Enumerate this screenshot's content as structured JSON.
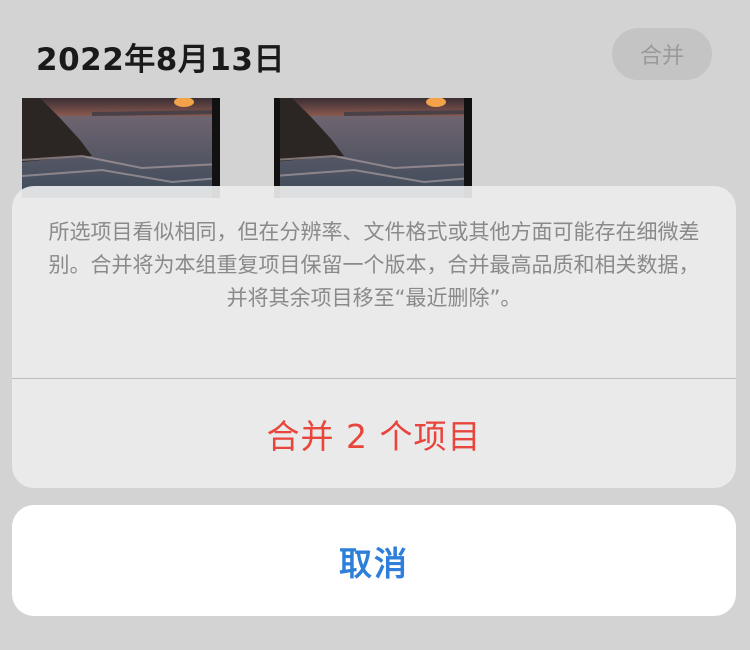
{
  "header": {
    "date_title": "2022年8月13日",
    "merge_label": "合并"
  },
  "thumbnails": [
    {
      "icon": "sunset-sea-photo"
    },
    {
      "icon": "sunset-sea-photo"
    }
  ],
  "action_sheet": {
    "message": "所选项目看似相同，但在分辨率、文件格式或其他方面可能存在细微差别。合并将为本组重复项目保留一个版本，合并最高品质和相关数据，并将其余项目移至“最近删除”。",
    "merge_action_label": "合并 2 个项目",
    "cancel_label": "取消"
  },
  "colors": {
    "destructive": "#e8453c",
    "accent": "#2e7fd9"
  }
}
